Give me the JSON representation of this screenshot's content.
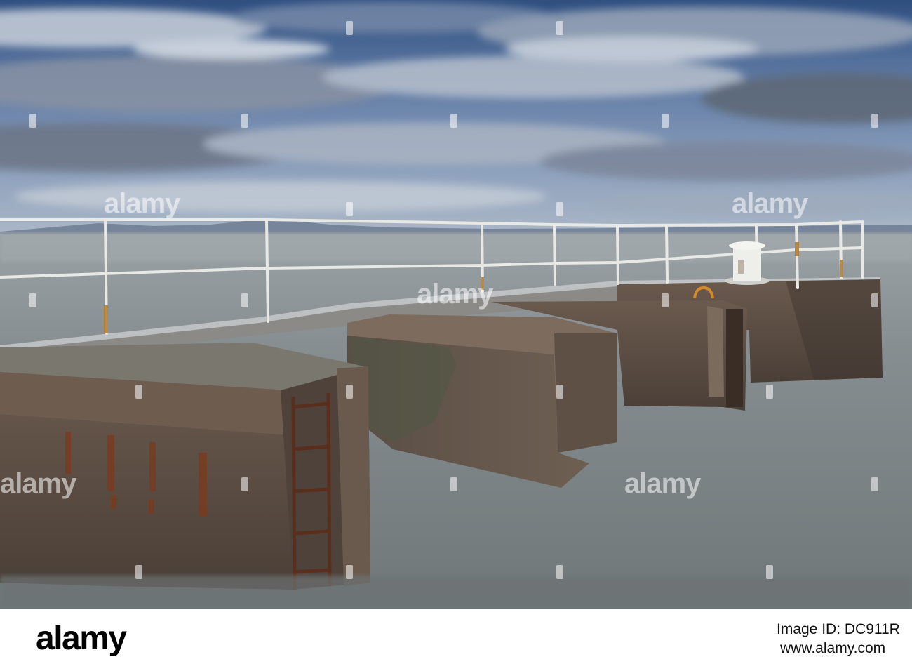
{
  "photo": {
    "subject": "Concrete pier with white railing and bollard over calm sea under streaked cloudy sky",
    "colors": {
      "sky_top": "#3a5d8e",
      "sky_mid": "#8ea4c2",
      "sea": "#7f8688",
      "concrete": "#5e5047",
      "rail": "#e8e8e4",
      "rust": "#b27a2a"
    }
  },
  "watermark": {
    "text": "alamy"
  },
  "footer": {
    "brand": "alamy",
    "image_id": "Image ID: DC911R",
    "url": "www.alamy.com"
  }
}
